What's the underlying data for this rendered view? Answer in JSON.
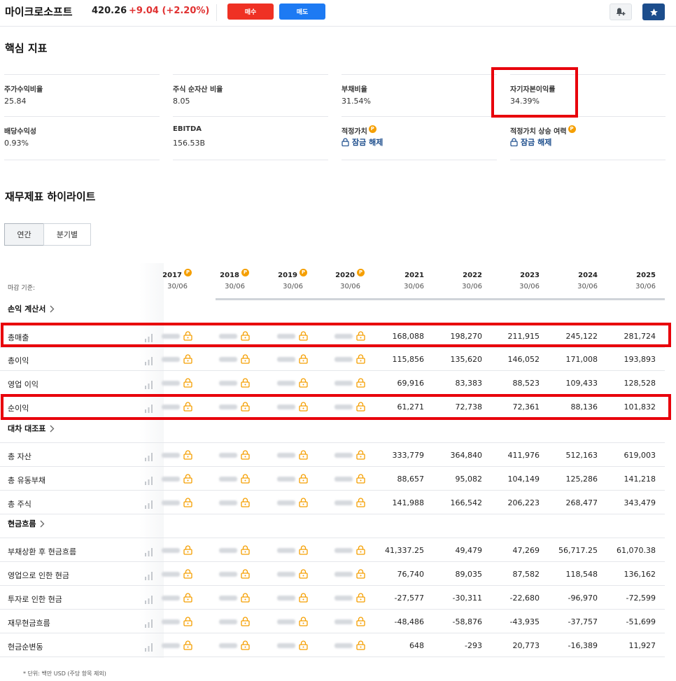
{
  "header": {
    "name": "마이크로소프트",
    "price": "420.26",
    "change": "+9.04  (+2.20%)",
    "buy_label": "매수",
    "sell_label": "매도"
  },
  "key_metrics": {
    "title": "핵심 지표",
    "items": [
      {
        "label": "주가수익비율",
        "value": "25.84"
      },
      {
        "label": "주식 순자산 비율",
        "value": "8.05"
      },
      {
        "label": "부채비율",
        "value": "31.54%"
      },
      {
        "label": "자기자본이익률",
        "value": "34.39%"
      },
      {
        "label": "배당수익성",
        "value": "0.93%"
      },
      {
        "label": "EBITDA",
        "value": "156.53B"
      },
      {
        "label": "적정가치",
        "value": "잠금 해제"
      },
      {
        "label": "적정가치 상승 여력",
        "value": "잠금 해제"
      }
    ]
  },
  "financials": {
    "title": "재무제표 하이라이트",
    "tabs": [
      "연간",
      "분기별"
    ],
    "deadline_label": "마감 기준:",
    "columns": [
      {
        "year": "2017",
        "date": "30/06",
        "locked": true
      },
      {
        "year": "2018",
        "date": "30/06",
        "locked": true
      },
      {
        "year": "2019",
        "date": "30/06",
        "locked": true
      },
      {
        "year": "2020",
        "date": "30/06",
        "locked": true
      },
      {
        "year": "2021",
        "date": "30/06",
        "locked": false
      },
      {
        "year": "2022",
        "date": "30/06",
        "locked": false
      },
      {
        "year": "2023",
        "date": "30/06",
        "locked": false
      },
      {
        "year": "2024",
        "date": "30/06",
        "locked": false
      },
      {
        "year": "2025",
        "date": "30/06",
        "locked": false
      }
    ],
    "groups": [
      {
        "title": "손익 계산서",
        "rows": [
          {
            "label": "총매출",
            "values": [
              "168,088",
              "198,270",
              "211,915",
              "245,122",
              "281,724"
            ]
          },
          {
            "label": "총이익",
            "values": [
              "115,856",
              "135,620",
              "146,052",
              "171,008",
              "193,893"
            ]
          },
          {
            "label": "영업 이익",
            "values": [
              "69,916",
              "83,383",
              "88,523",
              "109,433",
              "128,528"
            ]
          },
          {
            "label": "순이익",
            "values": [
              "61,271",
              "72,738",
              "72,361",
              "88,136",
              "101,832"
            ]
          }
        ]
      },
      {
        "title": "대차 대조표",
        "rows": [
          {
            "label": "총 자산",
            "values": [
              "333,779",
              "364,840",
              "411,976",
              "512,163",
              "619,003"
            ]
          },
          {
            "label": "총 유동부채",
            "values": [
              "88,657",
              "95,082",
              "104,149",
              "125,286",
              "141,218"
            ]
          },
          {
            "label": "총 주식",
            "values": [
              "141,988",
              "166,542",
              "206,223",
              "268,477",
              "343,479"
            ]
          }
        ]
      },
      {
        "title": "현금흐름",
        "rows": [
          {
            "label": "부채상환 후 현금흐름",
            "values": [
              "41,337.25",
              "49,479",
              "47,269",
              "56,717.25",
              "61,070.38"
            ]
          },
          {
            "label": "영업으로 인한 현금",
            "values": [
              "76,740",
              "89,035",
              "87,582",
              "118,548",
              "136,162"
            ]
          },
          {
            "label": "투자로 인한 현금",
            "values": [
              "-27,577",
              "-30,311",
              "-22,680",
              "-96,970",
              "-72,599"
            ]
          },
          {
            "label": "재무현금흐름",
            "values": [
              "-48,486",
              "-58,876",
              "-43,935",
              "-37,757",
              "-51,699"
            ]
          },
          {
            "label": "현금순변동",
            "values": [
              "648",
              "-293",
              "20,773",
              "-16,389",
              "11,927"
            ]
          }
        ]
      }
    ],
    "footnote": "* 단위: 백만 USD (주당 항목 제외)"
  },
  "colors": {
    "buy": "#ef3124",
    "sell": "#1d7af3",
    "up": "#e03131",
    "accent": "#1c4d8c",
    "highlight": "#e8000b",
    "pro_badge": "#f59f00"
  },
  "icons": {
    "alert": "bell-plus-icon",
    "star": "star-icon",
    "lock": "lock-icon",
    "bar": "bar-chart-icon",
    "chevron": "chevron-right-icon"
  }
}
